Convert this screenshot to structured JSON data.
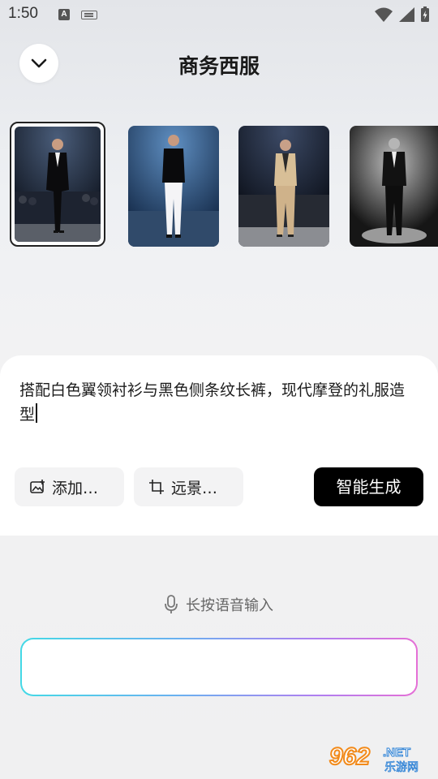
{
  "status_bar": {
    "time": "1:50",
    "input_icon_letter": "A"
  },
  "header": {
    "title": "商务西服"
  },
  "gallery": {
    "items": [
      {
        "name": "black-tuxedo-look",
        "selected": true
      },
      {
        "name": "white-trousers-look",
        "selected": false
      },
      {
        "name": "beige-suit-look",
        "selected": false
      },
      {
        "name": "spotlight-suit-look",
        "selected": false
      }
    ]
  },
  "editor": {
    "prompt_text": "搭配白色翼领衬衫与黑色侧条纹长裤，现代摩登的礼服造型",
    "add_chip_label": "添加…",
    "view_chip_label": "远景…",
    "generate_label": "智能生成"
  },
  "voice": {
    "hint": "长按语音输入"
  },
  "watermark": {
    "brand": "962",
    "suffix": ".NET",
    "subtitle": "乐游网"
  },
  "colors": {
    "accent_dark": "#000000",
    "voice_gradient_start": "#44d9e6",
    "voice_gradient_end": "#e56fd6"
  }
}
